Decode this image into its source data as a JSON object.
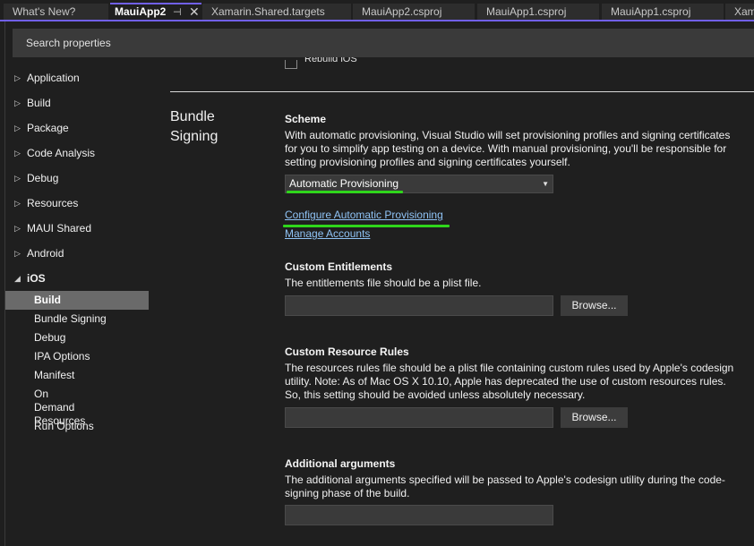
{
  "tabs": [
    {
      "label": "What's New?",
      "active": false
    },
    {
      "label": "MauiApp2",
      "active": true
    },
    {
      "label": "Xamarin.Shared.targets",
      "active": false
    },
    {
      "label": "MauiApp2.csproj",
      "active": false
    },
    {
      "label": "MauiApp1.csproj",
      "active": false
    },
    {
      "label": "MauiApp1.csproj",
      "active": false
    },
    {
      "label": "Xamarin.Shared.props",
      "active": false
    }
  ],
  "tab_icons": {
    "pin": "pin-icon",
    "close": "close-icon"
  },
  "search": {
    "placeholder": "Search properties",
    "value": ""
  },
  "sidebar": {
    "items": [
      {
        "label": "Application",
        "expanded": false
      },
      {
        "label": "Build",
        "expanded": false
      },
      {
        "label": "Package",
        "expanded": false
      },
      {
        "label": "Code Analysis",
        "expanded": false
      },
      {
        "label": "Debug",
        "expanded": false
      },
      {
        "label": "Resources",
        "expanded": false
      },
      {
        "label": "MAUI Shared",
        "expanded": false
      },
      {
        "label": "Android",
        "expanded": false
      },
      {
        "label": "iOS",
        "expanded": true
      }
    ],
    "ios_children": [
      {
        "label": "Build",
        "selected": true
      },
      {
        "label": "Bundle Signing",
        "selected": false
      },
      {
        "label": "Debug",
        "selected": false
      },
      {
        "label": "IPA Options",
        "selected": false
      },
      {
        "label": "Manifest",
        "selected": false
      },
      {
        "label": "On Demand Resources",
        "selected": false
      },
      {
        "label": "Run Options",
        "selected": false
      }
    ]
  },
  "main": {
    "top_checkbox_label": "Rebuild iOS",
    "section_title": "Bundle Signing",
    "scheme": {
      "title": "Scheme",
      "description": "With automatic provisioning, Visual Studio will set provisioning profiles and signing certificates for you to simplify app testing on a device. With manual provisioning, you'll be responsible for setting provisioning profiles and signing certificates yourself.",
      "selected": "Automatic Provisioning"
    },
    "links": {
      "configure": "Configure Automatic Provisioning",
      "manage": "Manage Accounts"
    },
    "custom_entitlements": {
      "title": "Custom Entitlements",
      "description": "The entitlements file should be a plist file.",
      "value": "",
      "browse_label": "Browse..."
    },
    "custom_resource_rules": {
      "title": "Custom Resource Rules",
      "description": "The resources rules file should be a plist file containing custom rules used by Apple's codesign utility. Note: As of Mac OS X 10.10, Apple has deprecated the use of custom resources rules. So, this setting should be avoided unless absolutely necessary.",
      "value": "",
      "browse_label": "Browse..."
    },
    "additional_arguments": {
      "title": "Additional arguments",
      "description": "The additional arguments specified will be passed to Apple's codesign utility during the code-signing phase of the build.",
      "value": ""
    }
  },
  "colors": {
    "accent": "#7160e8",
    "highlight_annotation": "#2fd61b",
    "link": "#8fc3f5",
    "background": "#1f1f1f"
  }
}
